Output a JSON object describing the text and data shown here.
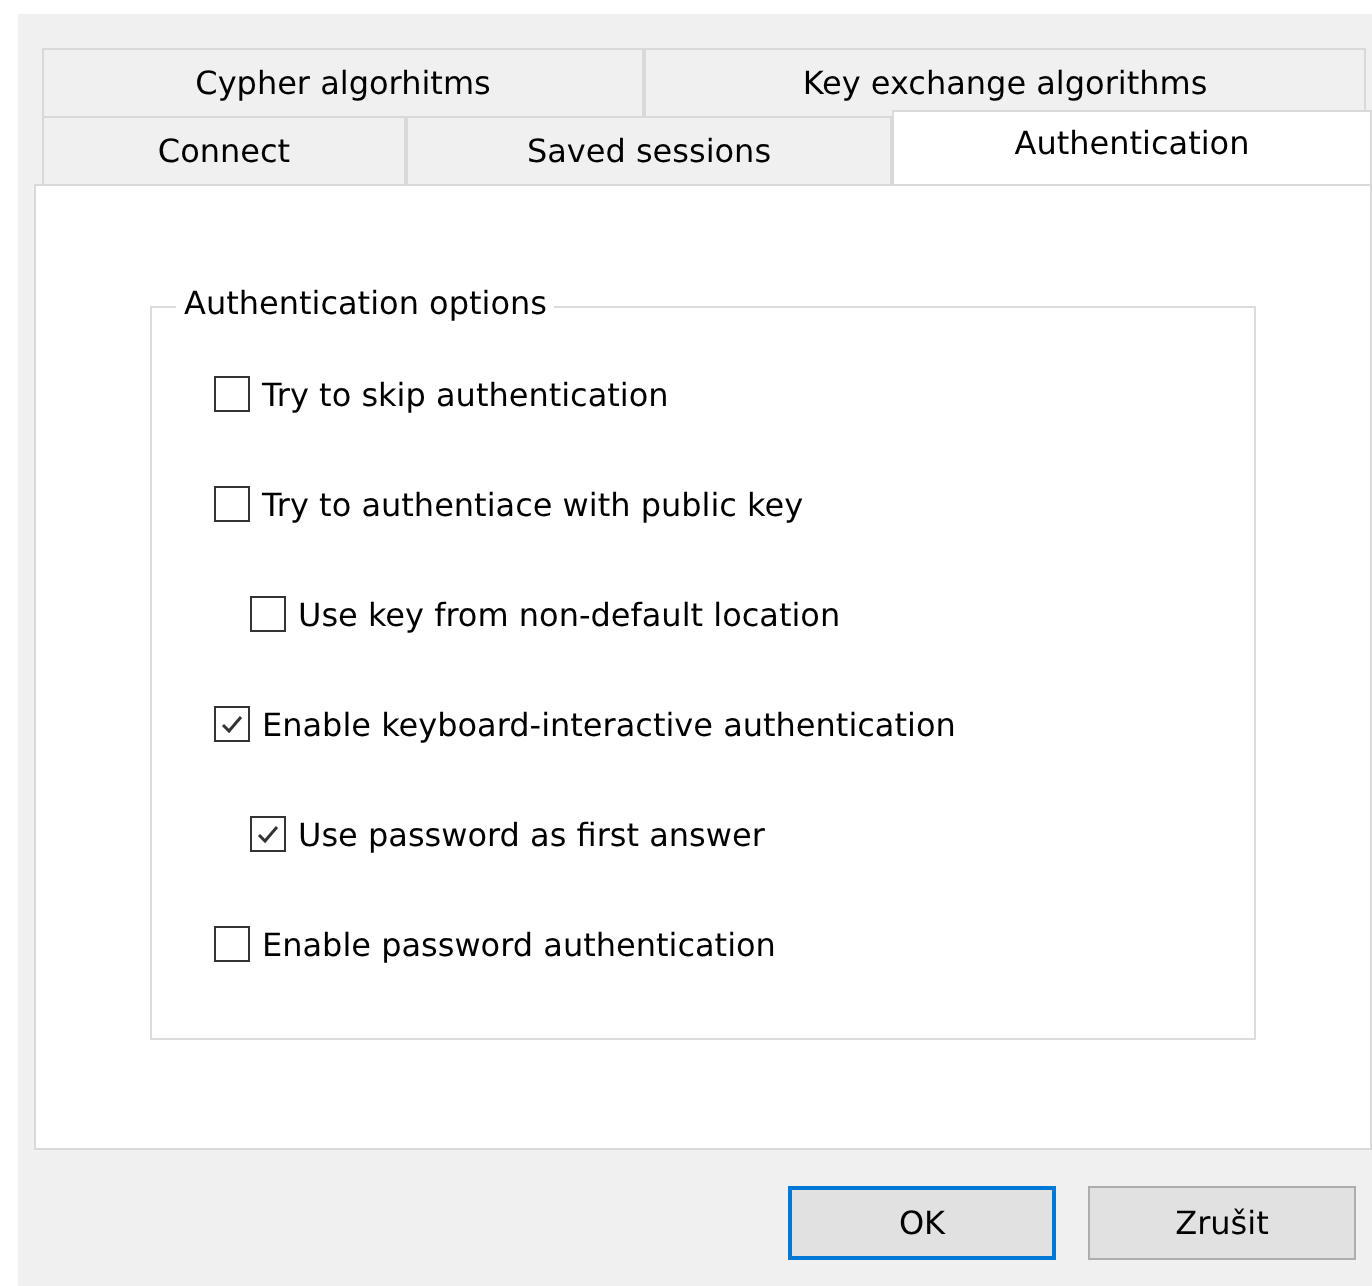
{
  "tab_rows": [
    [
      {
        "label": "Cypher algorhitms",
        "selected": false
      },
      {
        "label": "Key exchange algorithms",
        "selected": false
      }
    ],
    [
      {
        "label": "Connect",
        "selected": false
      },
      {
        "label": "Saved sessions",
        "selected": false
      },
      {
        "label": "Authentication",
        "selected": true
      }
    ]
  ],
  "group": {
    "title": "Authentication options",
    "options": [
      {
        "label": "Try to skip authentication",
        "checked": false
      },
      {
        "label": "Try to authentiace with public key",
        "checked": false,
        "children": [
          {
            "label": "Use key from non-default location",
            "checked": false
          }
        ]
      },
      {
        "label": "Enable keyboard-interactive authentication",
        "checked": true,
        "children": [
          {
            "label": "Use password as first answer",
            "checked": true
          }
        ]
      },
      {
        "label": "Enable password authentication",
        "checked": false
      }
    ]
  },
  "buttons": [
    {
      "label": "OK",
      "default": true
    },
    {
      "label": "Zrušit",
      "default": false
    }
  ]
}
